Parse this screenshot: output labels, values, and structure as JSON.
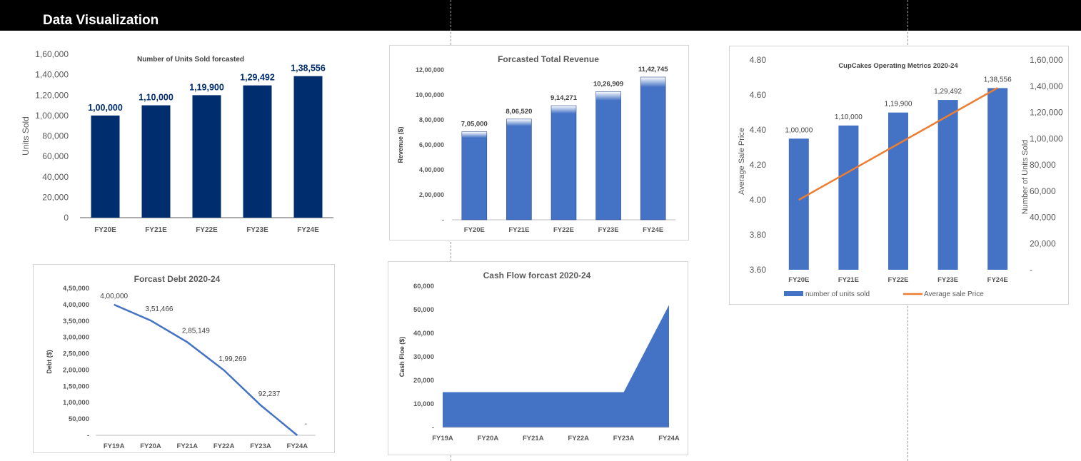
{
  "header": {
    "title": "Data Visualization"
  },
  "colors": {
    "navy": "#002d6e",
    "blue": "#4472c4",
    "orange": "#ed7d31",
    "axis": "#595959",
    "label_dark": "#404040"
  },
  "chart_data": [
    {
      "id": "units",
      "type": "bar",
      "title": "Number of Units Sold forcasted",
      "ylabel": "Units Sold",
      "xlabel": "",
      "categories": [
        "FY20E",
        "FY21E",
        "FY22E",
        "FY23E",
        "FY24E"
      ],
      "values": [
        100000,
        110000,
        119900,
        129492,
        138556
      ],
      "data_labels": [
        "1,00,000",
        "1,10,000",
        "1,19,900",
        "1,29,492",
        "1,38,556"
      ],
      "ylim": [
        0,
        160000
      ],
      "yticks": [
        0,
        20000,
        40000,
        60000,
        80000,
        100000,
        120000,
        140000,
        160000
      ],
      "ytick_labels": [
        "0",
        "20,000",
        "40,000",
        "60,000",
        "80,000",
        "1,00,000",
        "1,20,000",
        "1,40,000",
        "1,60,000"
      ],
      "grid": false
    },
    {
      "id": "revenue",
      "type": "bar",
      "title": "Forcasted Total Revenue",
      "ylabel": "Revenue ($)",
      "xlabel": "",
      "categories": [
        "FY20E",
        "FY21E",
        "FY22E",
        "FY23E",
        "FY24E"
      ],
      "values": [
        705000,
        806520,
        914271,
        1026909,
        1142745
      ],
      "data_labels": [
        "7,05,000",
        "8,06,520",
        "9,14,271",
        "10,26,909",
        "11,42,745"
      ],
      "ylim": [
        0,
        1200000
      ],
      "yticks": [
        0,
        200000,
        400000,
        600000,
        800000,
        1000000,
        1200000
      ],
      "ytick_labels": [
        "-",
        "2,00,000",
        "4,00,000",
        "6,00,000",
        "8,00,000",
        "10,00,000",
        "12,00,000"
      ],
      "grid": false
    },
    {
      "id": "metrics",
      "type": "bar",
      "title": "CupCakes Operating Metrics 2020-24",
      "ylabel": "Average Sale Price",
      "y2label": "Number of Units Sold",
      "xlabel": "",
      "categories": [
        "FY20E",
        "FY21E",
        "FY22E",
        "FY23E",
        "FY24E"
      ],
      "series": [
        {
          "name": "number of units sold",
          "kind": "bar",
          "axis": "right",
          "values": [
            100000,
            110000,
            119900,
            129492,
            138556
          ],
          "data_labels": [
            "1,00,000",
            "1,10,000",
            "1,19,900",
            "1,29,492",
            "1,38,556"
          ]
        },
        {
          "name": "Average sale Price",
          "kind": "line",
          "axis": "left",
          "values": [
            4.0,
            4.16,
            4.32,
            4.48,
            4.64
          ]
        }
      ],
      "ylim": [
        3.6,
        4.8
      ],
      "yticks": [
        3.6,
        3.8,
        4.0,
        4.2,
        4.4,
        4.6,
        4.8
      ],
      "ytick_labels": [
        "3.60",
        "3.80",
        "4.00",
        "4.20",
        "4.40",
        "4.60",
        "4.80"
      ],
      "y2lim": [
        0,
        160000
      ],
      "y2ticks": [
        0,
        20000,
        40000,
        60000,
        80000,
        100000,
        120000,
        140000,
        160000
      ],
      "y2tick_labels": [
        "-",
        "20,000",
        "40,000",
        "60,000",
        "80,000",
        "1,00,000",
        "1,20,000",
        "1,40,000",
        "1,60,000"
      ],
      "legend": "bottom",
      "grid": false
    },
    {
      "id": "debt",
      "type": "line",
      "title": "Forcast Debt 2020-24",
      "ylabel": "Debt ($)",
      "xlabel": "",
      "categories": [
        "FY19A",
        "FY20A",
        "FY21A",
        "FY22A",
        "FY23A",
        "FY24A"
      ],
      "values": [
        400000,
        351466,
        285149,
        199269,
        92237,
        0
      ],
      "data_labels": [
        "4,00,000",
        "3,51,466",
        "2,85,149",
        "1,99,269",
        "92,237",
        "-"
      ],
      "ylim": [
        0,
        450000
      ],
      "yticks": [
        0,
        50000,
        100000,
        150000,
        200000,
        250000,
        300000,
        350000,
        400000,
        450000
      ],
      "ytick_labels": [
        "-",
        "50,000",
        "1,00,000",
        "1,50,000",
        "2,00,000",
        "2,50,000",
        "3,00,000",
        "3,50,000",
        "4,00,000",
        "4,50,000"
      ],
      "grid": false
    },
    {
      "id": "cash",
      "type": "area",
      "title": "Cash Flow forcast 2020-24",
      "ylabel": "Cash Floe ($)",
      "xlabel": "",
      "categories": [
        "FY19A",
        "FY20A",
        "FY21A",
        "FY22A",
        "FY23A",
        "FY24A"
      ],
      "values": [
        15000,
        15000,
        15000,
        15000,
        15000,
        52000
      ],
      "ylim": [
        0,
        60000
      ],
      "yticks": [
        0,
        10000,
        20000,
        30000,
        40000,
        50000,
        60000
      ],
      "ytick_labels": [
        "-",
        "10,000",
        "20,000",
        "30,000",
        "40,000",
        "50,000",
        "60,000"
      ],
      "grid": false
    }
  ]
}
